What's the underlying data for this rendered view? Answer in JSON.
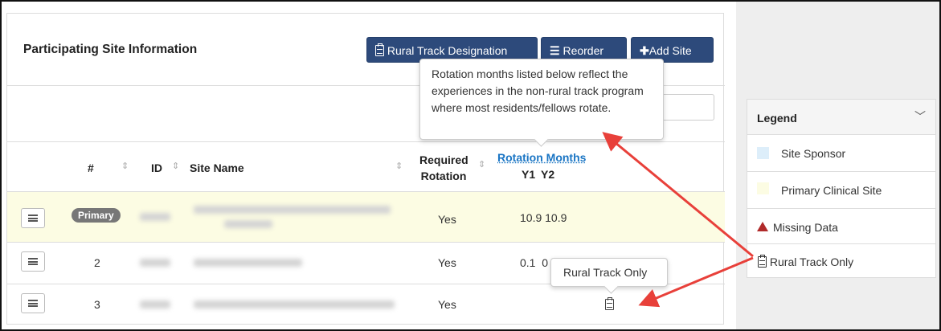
{
  "panel": {
    "title": "Participating Site Information",
    "buttons": {
      "rural_track": "Rural Track Designation",
      "reorder": "Reorder",
      "add_site": "Add Site"
    },
    "search_placeholder": ""
  },
  "table": {
    "headers": {
      "num": "#",
      "id": "ID",
      "site_name": "Site Name",
      "required_line1": "Required",
      "required_line2": "Rotation",
      "rotation_months": "Rotation Months",
      "y1": "Y1",
      "y2": "Y2"
    },
    "rows": [
      {
        "num": "Primary",
        "required": "Yes",
        "months": "10.9 10.9",
        "type": "primary"
      },
      {
        "num": "2",
        "required": "Yes",
        "months": "0.1  0",
        "type": "normal"
      },
      {
        "num": "3",
        "required": "Yes",
        "months": "",
        "type": "rural"
      }
    ]
  },
  "tooltips": {
    "rotation": "Rotation months listed below reflect the experiences in the non-rural track program where most residents/fellows rotate.",
    "rural": "Rural Track Only"
  },
  "legend": {
    "title": "Legend",
    "items": [
      {
        "label": "Site Sponsor",
        "color": "#ddeefa"
      },
      {
        "label": "Primary Clinical Site",
        "color": "#fcfce3"
      },
      {
        "label": "Missing Data",
        "icon": "warning-icon"
      },
      {
        "label": "Rural Track Only",
        "icon": "clipboard-icon"
      }
    ]
  },
  "colors": {
    "button": "#2d4a7b",
    "link": "#1a75c4",
    "arrow": "#e8403a",
    "primary_row": "#fcfce3"
  }
}
